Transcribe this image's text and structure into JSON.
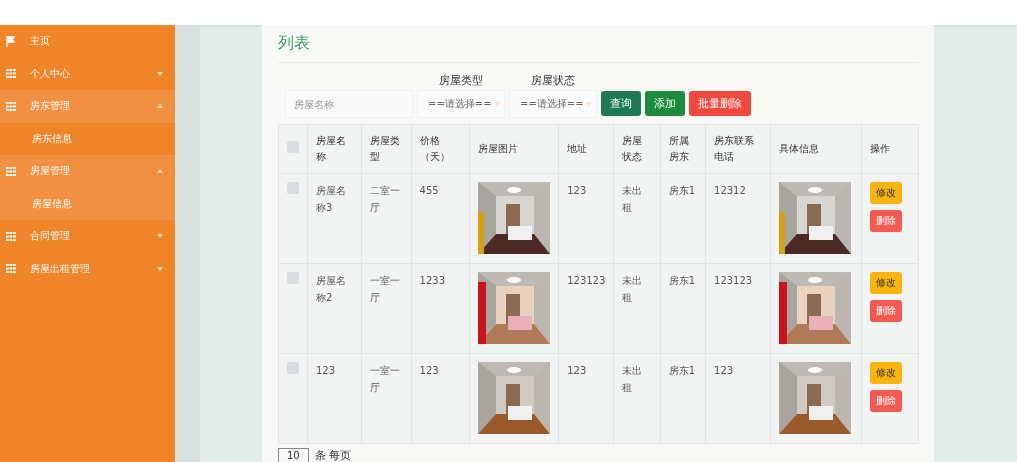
{
  "sidebar": {
    "items": [
      {
        "label": "主页",
        "kind": "link",
        "expanded": false
      },
      {
        "label": "个人中心",
        "kind": "group",
        "expanded": false
      },
      {
        "label": "房东管理",
        "kind": "group",
        "expanded": true,
        "children": [
          {
            "label": "房东信息",
            "selected": false
          }
        ]
      },
      {
        "label": "房屋管理",
        "kind": "group",
        "expanded": true,
        "children": [
          {
            "label": "房屋信息",
            "selected": true
          }
        ]
      },
      {
        "label": "合同管理",
        "kind": "group",
        "expanded": false
      },
      {
        "label": "房屋出租管理",
        "kind": "group",
        "expanded": false
      }
    ]
  },
  "panel": {
    "title": "列表",
    "filters": {
      "name": {
        "placeholder": "房屋名称"
      },
      "type": {
        "label": "房屋类型",
        "value": "==请选择=="
      },
      "status": {
        "label": "房屋状态",
        "value": "==请选择=="
      }
    },
    "buttons": [
      {
        "label": "查询",
        "kind": "search"
      },
      {
        "label": "添加",
        "kind": "add"
      },
      {
        "label": "批量删除",
        "kind": "danger"
      }
    ],
    "table": {
      "columns": [
        "房屋名称",
        "房屋类型",
        "价格（天）",
        "房屋图片",
        "地址",
        "房屋状态",
        "所属房东",
        "房东联系电话",
        "具体信息",
        "操作"
      ],
      "header_checked": false,
      "rows": [
        {
          "checked": false,
          "name": "房屋名称3",
          "type": "二室一厅",
          "price": "455",
          "address": "123",
          "status": "未出租",
          "owner": "房东1",
          "phone": "12312",
          "actions": [
            "修改",
            "删除"
          ]
        },
        {
          "checked": false,
          "name": "房屋名称2",
          "type": "一室一厅",
          "price": "1233",
          "address": "123123",
          "status": "未出租",
          "owner": "房东1",
          "phone": "123123",
          "actions": [
            "修改",
            "删除"
          ]
        },
        {
          "checked": false,
          "name": "123",
          "type": "一室一厅",
          "price": "123",
          "address": "123",
          "status": "未出租",
          "owner": "房东1",
          "phone": "123",
          "actions": [
            "修改",
            "删除"
          ]
        }
      ]
    },
    "pagination": {
      "page_size": "10",
      "label": "条 每页"
    }
  }
}
